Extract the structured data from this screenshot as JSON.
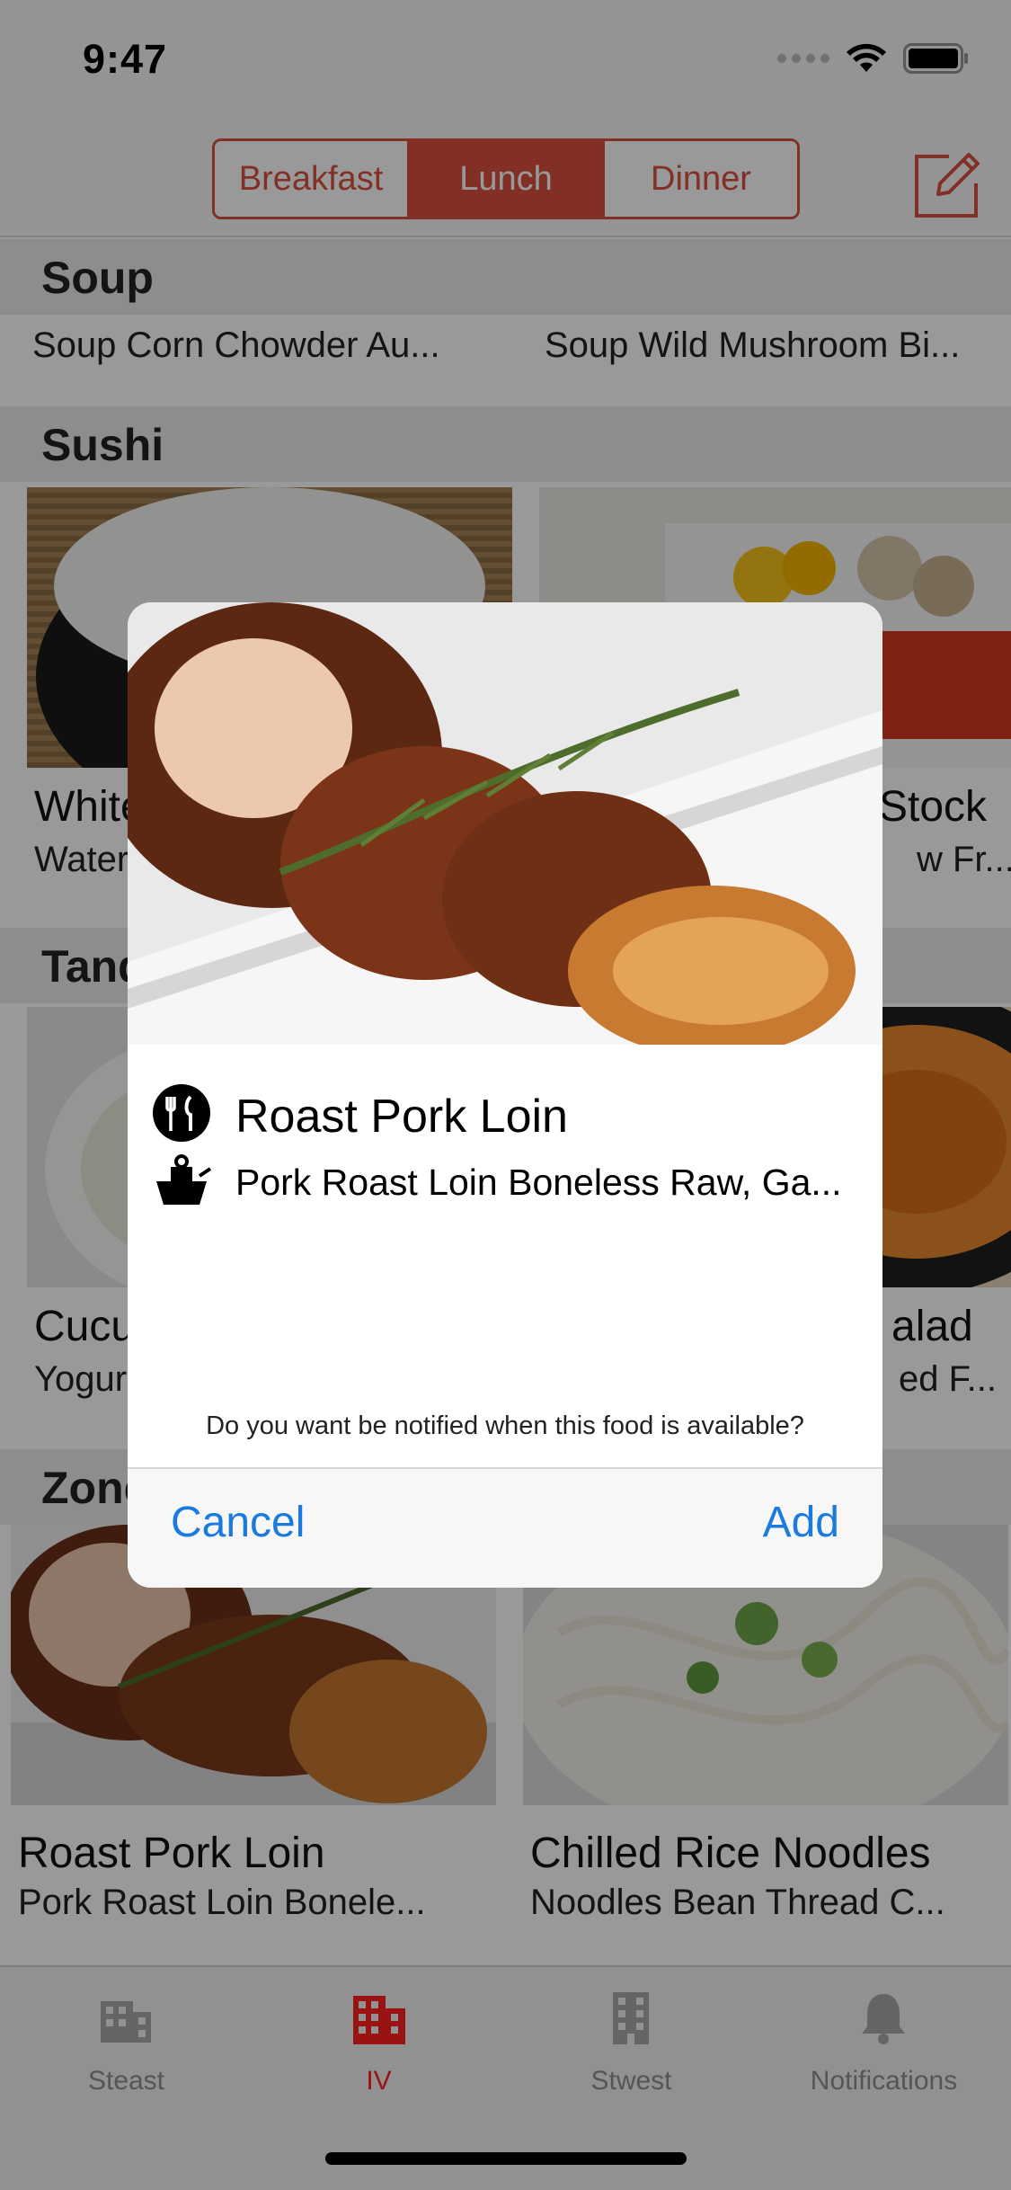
{
  "status_bar": {
    "time": "9:47"
  },
  "nav": {
    "segments": [
      "Breakfast",
      "Lunch",
      "Dinner"
    ],
    "selected_segment": "Lunch",
    "compose_icon": "compose-icon"
  },
  "sections": [
    {
      "header": "Soup",
      "items": [
        {
          "title": "Corn Chowder",
          "subtitle": "Soup Corn Chowder Au..."
        },
        {
          "title": "Wild Mushroom Bisque",
          "subtitle": "Soup Wild Mushroom Bi..."
        }
      ]
    },
    {
      "header": "Sushi",
      "items": [
        {
          "title": "White",
          "subtitle": "Water"
        },
        {
          "title": "Stock",
          "subtitle": "w Fr..."
        }
      ]
    },
    {
      "header": "Tand",
      "items": [
        {
          "title": "Cucu",
          "subtitle": "Yogur"
        },
        {
          "title": "alad",
          "subtitle": "ed F..."
        }
      ]
    },
    {
      "header": "Zone",
      "items": [
        {
          "title": "Roast Pork Loin",
          "subtitle": "Pork Roast Loin Bonele..."
        },
        {
          "title": "Chilled Rice Noodles",
          "subtitle": "Noodles Bean Thread C..."
        }
      ]
    }
  ],
  "tabs": [
    {
      "label": "Steast",
      "icon": "building-icon",
      "active": false
    },
    {
      "label": "IV",
      "icon": "building-icon",
      "active": true
    },
    {
      "label": "Stwest",
      "icon": "building-icon",
      "active": false
    },
    {
      "label": "Notifications",
      "icon": "bell-icon",
      "active": false
    }
  ],
  "alert": {
    "title": "Roast Pork Loin",
    "subtitle": "Pork Roast Loin Boneless Raw, Ga...",
    "message": "Do you want be notified when this food is available?",
    "cancel_label": "Cancel",
    "add_label": "Add"
  },
  "colors": {
    "accent": "#d9503f",
    "active_tab": "#ff2020",
    "link_blue": "#1a7ae0"
  }
}
